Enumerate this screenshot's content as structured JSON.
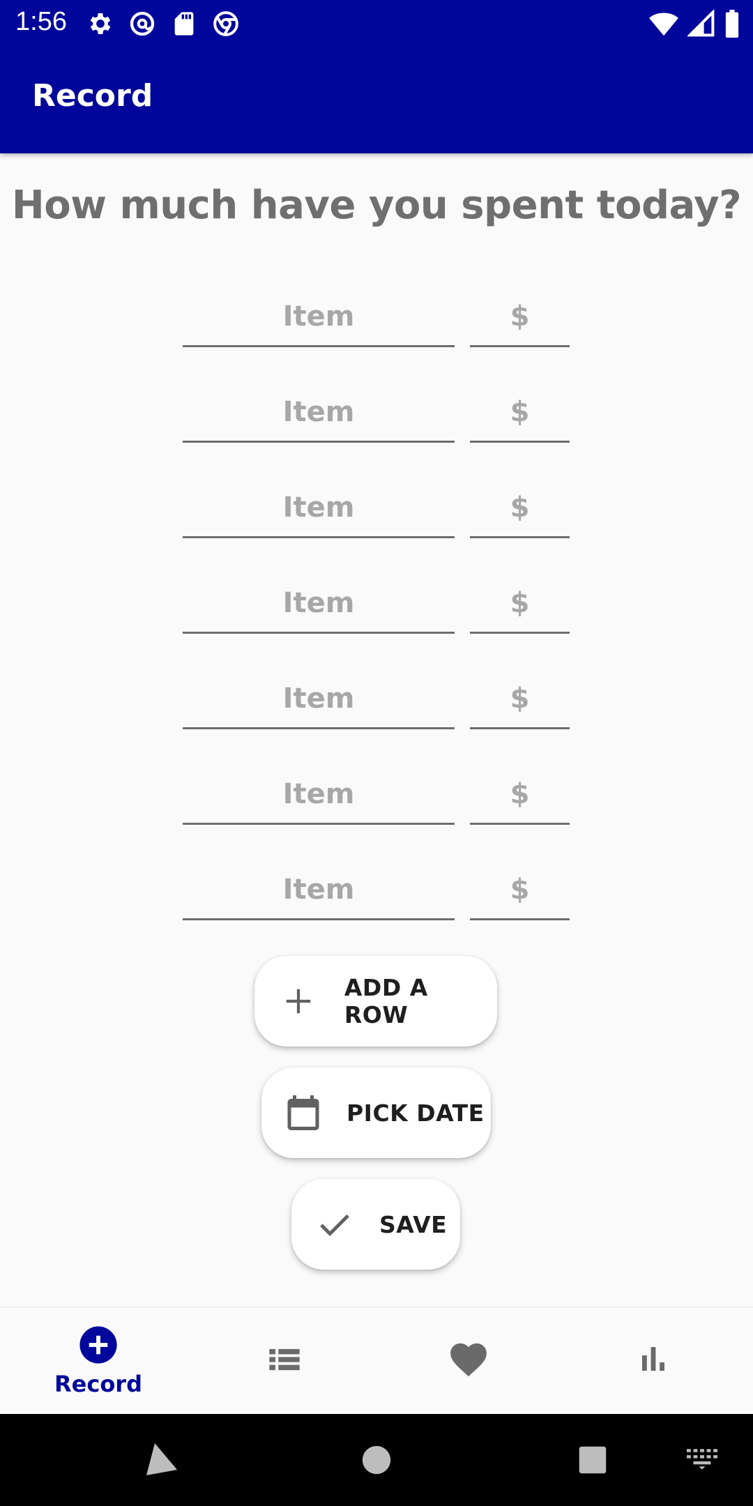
{
  "status_bar": {
    "time": "1:56",
    "left_icons": [
      "gear-icon",
      "at-sign-icon",
      "sd-card-icon",
      "chrome-icon"
    ],
    "right_icons": [
      "wifi-icon",
      "cell-signal-icon",
      "battery-icon"
    ]
  },
  "app_bar": {
    "title": "Record"
  },
  "form": {
    "question": "How much have you spent today?",
    "rows": [
      {
        "item_placeholder": "Item",
        "amount_placeholder": "$"
      },
      {
        "item_placeholder": "Item",
        "amount_placeholder": "$"
      },
      {
        "item_placeholder": "Item",
        "amount_placeholder": "$"
      },
      {
        "item_placeholder": "Item",
        "amount_placeholder": "$"
      },
      {
        "item_placeholder": "Item",
        "amount_placeholder": "$"
      },
      {
        "item_placeholder": "Item",
        "amount_placeholder": "$"
      },
      {
        "item_placeholder": "Item",
        "amount_placeholder": "$"
      }
    ]
  },
  "actions": {
    "add_row_label": "ADD A ROW",
    "pick_date_label": "PICK DATE",
    "save_label": "SAVE"
  },
  "bottom_nav": {
    "items": [
      {
        "icon": "add-circle-icon",
        "label": "Record",
        "active": true
      },
      {
        "icon": "list-icon",
        "label": "",
        "active": false
      },
      {
        "icon": "heart-icon",
        "label": "",
        "active": false
      },
      {
        "icon": "bar-chart-icon",
        "label": "",
        "active": false
      }
    ]
  },
  "colors": {
    "primary": "#00079a",
    "background": "#fafafa",
    "heading_text": "#6f6f6f",
    "placeholder_text": "#a7a7a7",
    "icon_gray": "#616161"
  }
}
